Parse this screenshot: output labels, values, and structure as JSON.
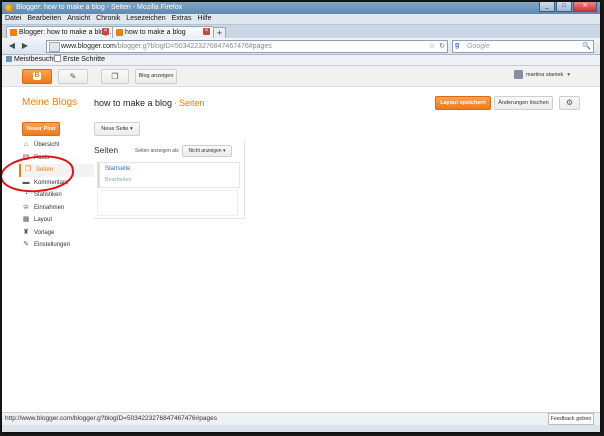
{
  "window": {
    "title": "Blogger: how to make a blog - Seiten - Mozilla Firefox",
    "controls": {
      "minimize": "_",
      "maximize": "□",
      "close": "✕"
    }
  },
  "menubar": [
    "Datei",
    "Bearbeiten",
    "Ansicht",
    "Chronik",
    "Lesezeichen",
    "Extras",
    "Hilfe"
  ],
  "tabs": [
    {
      "label": "Blogger: how to make a blog...",
      "close": "×"
    },
    {
      "label": "how to make a blog",
      "close": "×"
    }
  ],
  "newtab": "+",
  "navbar": {
    "back": "◀",
    "forward": "▶",
    "home_icon": "home-icon",
    "url_host": "www.blogger.com",
    "url_path": "/blogger.g?blogID=5034223276847467476#pages",
    "star": "☆",
    "reload": "↻",
    "search_placeholder": "Google",
    "search_engine": "g",
    "search_go": "🔍"
  },
  "bookmarks": [
    {
      "label": "Meistbesucht"
    },
    {
      "label": "Erste Schritte"
    }
  ],
  "topbar": {
    "view_blog": "Blog anzeigen",
    "user_name": "martina staniek",
    "caret": "▼",
    "blogger_glyph": "B",
    "pencil_glyph": "✎",
    "pages_glyph": "❐"
  },
  "header": {
    "my_blogs": "Meine Blogs",
    "blog_name": "how to make a blog",
    "separator": "·",
    "section": "Seiten",
    "save_layout": "Layout speichern",
    "discard_changes": "Änderungen löschen",
    "gear": "⚙"
  },
  "sidebar": {
    "new_post": "Neuer Post",
    "items": [
      {
        "label": "Übersicht",
        "icon": "⌂"
      },
      {
        "label": "Posts",
        "icon": "▤"
      },
      {
        "label": "Seiten",
        "icon": "❐"
      },
      {
        "label": "Kommentare",
        "icon": "▬"
      },
      {
        "label": "Statistiken",
        "icon": "◔"
      },
      {
        "label": "Einnahmen",
        "icon": "♔"
      },
      {
        "label": "Layout",
        "icon": "▦"
      },
      {
        "label": "Vorlage",
        "icon": "♜"
      },
      {
        "label": "Einstellungen",
        "icon": "✎"
      }
    ]
  },
  "main": {
    "new_page": "Neue Seite ▾",
    "panel_title": "Seiten",
    "show_as_label": "Seiten anzeigen als",
    "show_as_value": "Nicht anzeigen ▾",
    "pages": [
      {
        "title": "Startseite",
        "edit": "Bearbeiten"
      }
    ]
  },
  "statusbar": {
    "url": "http://www.blogger.com/blogger.g?blogID=5034223276847467476#pages",
    "feedback": "Feedback geben"
  },
  "colors": {
    "accent": "#f57d00",
    "link": "#3366cc",
    "annotation": "#e31010"
  }
}
